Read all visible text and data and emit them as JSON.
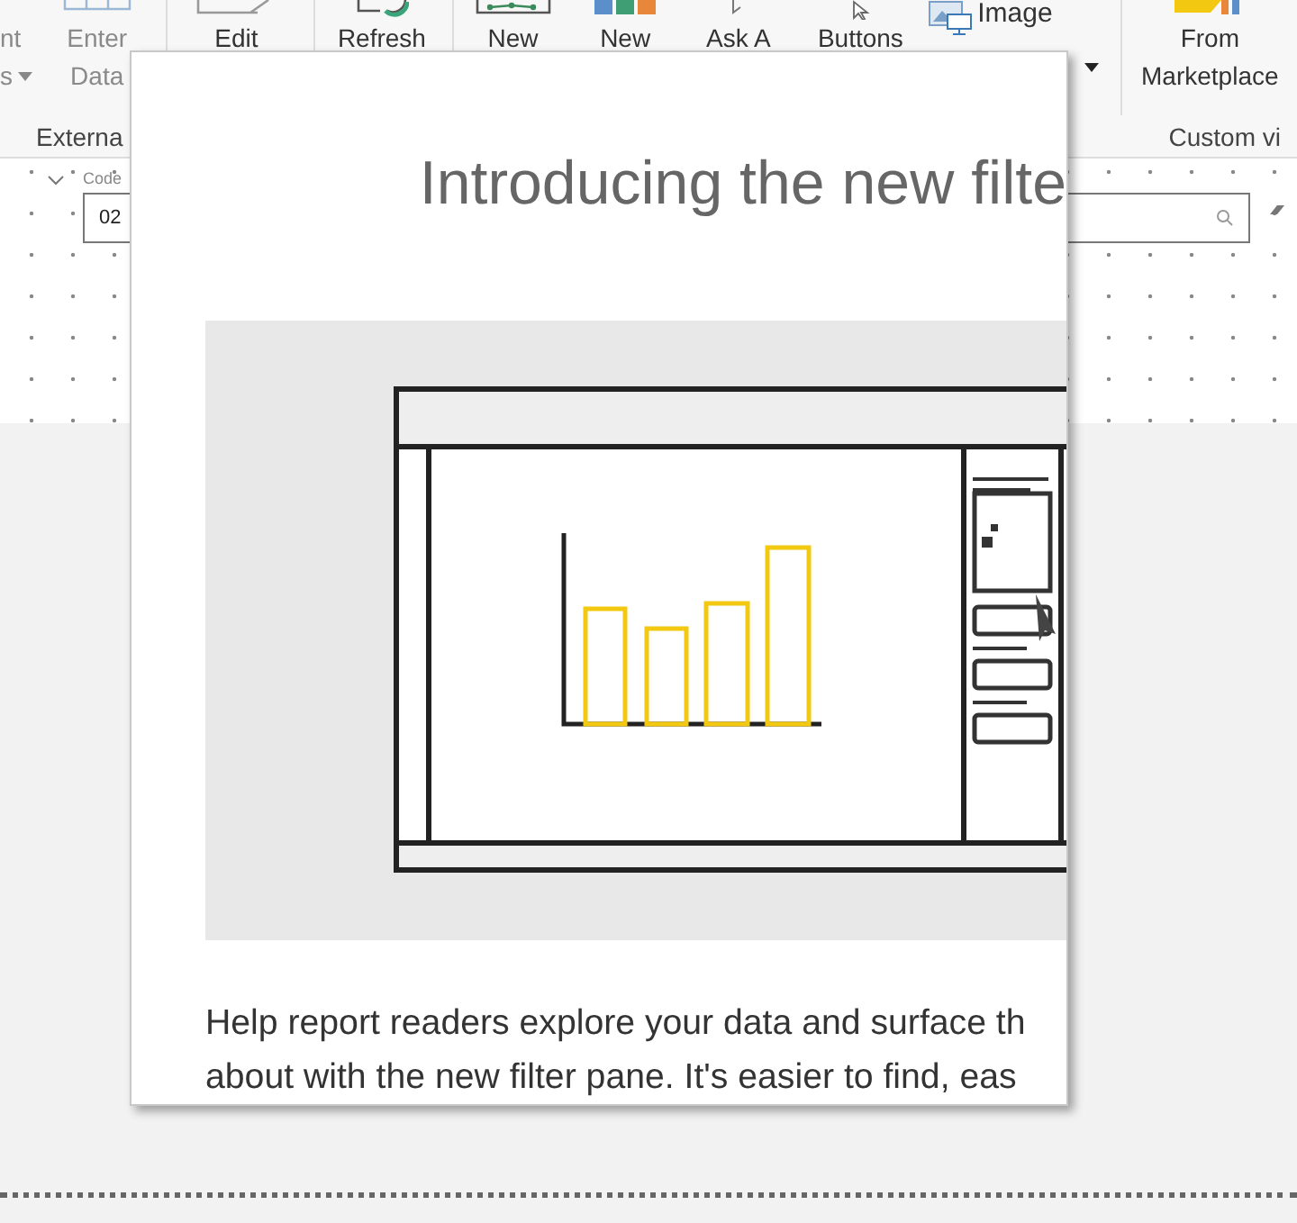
{
  "ribbon": {
    "items": [
      {
        "kind": "dropdown",
        "lines": [
          "nt",
          "s"
        ],
        "disabled": true
      },
      {
        "kind": "large",
        "lines": [
          "Enter",
          "Data"
        ],
        "disabled": true
      },
      {
        "kind": "large",
        "lines": [
          "Edit"
        ],
        "disabled": false
      },
      {
        "kind": "large",
        "lines": [
          "Refresh"
        ],
        "disabled": false
      },
      {
        "kind": "large",
        "lines": [
          "New"
        ],
        "disabled": false
      },
      {
        "kind": "large",
        "lines": [
          "New"
        ],
        "disabled": false
      },
      {
        "kind": "large",
        "lines": [
          "Ask A"
        ],
        "disabled": false
      },
      {
        "kind": "large",
        "lines": [
          "Buttons"
        ],
        "disabled": false
      },
      {
        "kind": "small",
        "lines": [
          "Image"
        ],
        "disabled": false
      },
      {
        "kind": "more",
        "disabled": false
      },
      {
        "kind": "large",
        "lines": [
          "From",
          "Marketplace"
        ],
        "disabled": false
      }
    ],
    "group_labels": [
      "Externa",
      "Custom vi"
    ]
  },
  "slicer": {
    "label": "Code",
    "value": "02"
  },
  "dialog": {
    "title": "Introducing the new filte",
    "body": [
      "Help report readers explore your data and surface th",
      "about with the new filter pane. It's easier to find, eas"
    ]
  }
}
